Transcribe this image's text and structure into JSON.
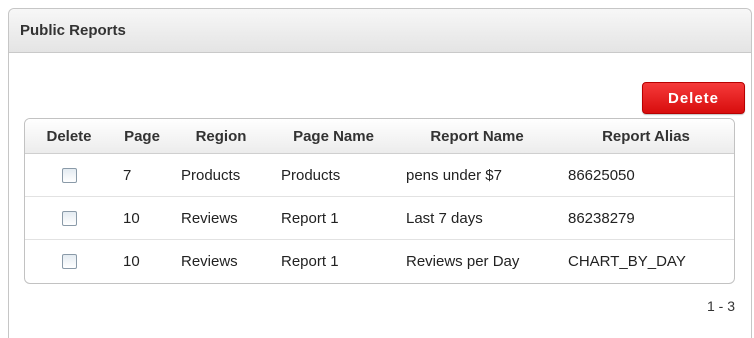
{
  "region": {
    "title": "Public Reports"
  },
  "toolbar": {
    "delete_label": "Delete"
  },
  "table": {
    "headers": [
      "Delete",
      "Page",
      "Region",
      "Page Name",
      "Report Name",
      "Report Alias"
    ],
    "rows": [
      {
        "page": "7",
        "region": "Products",
        "page_name": "Products",
        "report_name": "pens under $7",
        "alias": "86625050"
      },
      {
        "page": "10",
        "region": "Reviews",
        "page_name": "Report 1",
        "report_name": "Last 7 days",
        "alias": "86238279"
      },
      {
        "page": "10",
        "region": "Reviews",
        "page_name": "Report 1",
        "report_name": "Reviews per Day",
        "alias": "CHART_BY_DAY"
      }
    ]
  },
  "pagination": {
    "range": "1 - 3"
  }
}
